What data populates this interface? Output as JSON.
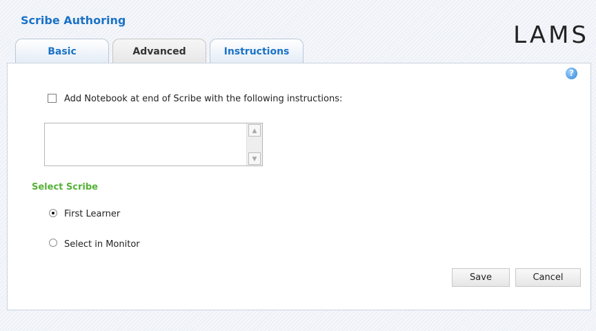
{
  "app": {
    "title": "Scribe Authoring",
    "logo_text": "LAMS"
  },
  "tabs": [
    {
      "label": "Basic",
      "active": false
    },
    {
      "label": "Advanced",
      "active": true
    },
    {
      "label": "Instructions",
      "active": false
    }
  ],
  "help": {
    "icon": "question-mark-icon",
    "glyph": "?"
  },
  "notebook": {
    "checkbox_label": "Add Notebook at end of Scribe with the following instructions:",
    "checked": false,
    "instructions_value": ""
  },
  "select_scribe": {
    "title": "Select Scribe",
    "options": [
      {
        "label": "First Learner",
        "selected": true
      },
      {
        "label": "Select in Monitor",
        "selected": false
      }
    ]
  },
  "buttons": {
    "save": "Save",
    "cancel": "Cancel"
  },
  "colors": {
    "accent": "#1b72c7",
    "section_green": "#55b236"
  }
}
